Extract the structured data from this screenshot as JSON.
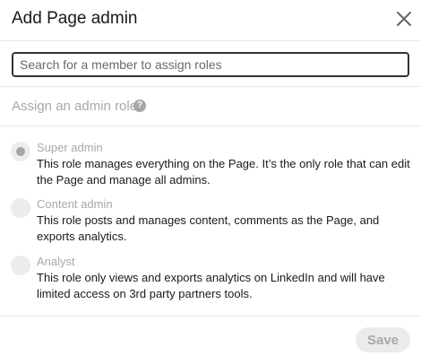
{
  "dialog": {
    "title": "Add Page admin",
    "close_icon": "close-icon"
  },
  "search": {
    "placeholder": "Search for a member to assign roles",
    "value": ""
  },
  "section": {
    "label": "Assign an admin role",
    "help_icon": "help-circle-icon",
    "help_glyph": "?"
  },
  "roles": [
    {
      "name": "Super admin",
      "description": "This role manages everything on the Page. It’s the only role that can edit the Page and manage all admins.",
      "selected": true
    },
    {
      "name": "Content admin",
      "description": "This role posts and manages content, comments as the Page, and exports analytics.",
      "selected": false
    },
    {
      "name": "Analyst",
      "description": "This role only views and exports analytics on LinkedIn and will have limited access on 3rd party partners tools.",
      "selected": false
    }
  ],
  "footer": {
    "save_label": "Save"
  },
  "colors": {
    "disabled_text": "#a8a8a8",
    "divider": "#e9e9e9",
    "input_border": "#333333"
  }
}
